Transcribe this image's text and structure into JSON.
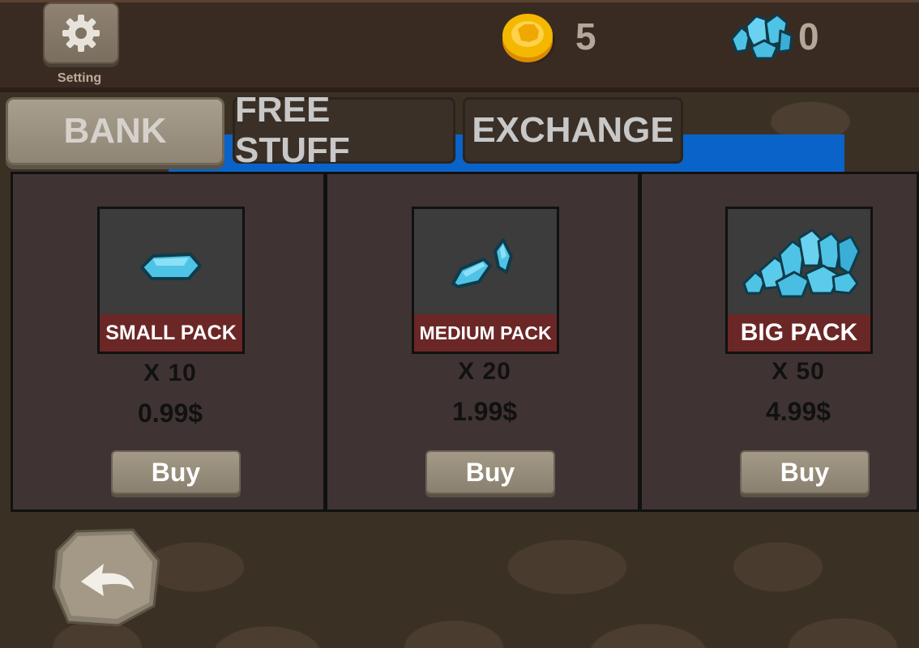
{
  "header": {
    "setting_label": "Setting",
    "coins": "5",
    "gems": "0"
  },
  "tabs": [
    {
      "label": "BANK"
    },
    {
      "label": "FREE STUFF"
    },
    {
      "label": "EXCHANGE"
    }
  ],
  "packs": [
    {
      "name": "SMALL PACK",
      "quantity": "X 10",
      "price": "0.99$",
      "buy_label": "Buy"
    },
    {
      "name": "MEDIUM PACK",
      "quantity": "X 20",
      "price": "1.99$",
      "buy_label": "Buy"
    },
    {
      "name": "BIG PACK",
      "quantity": "X 50",
      "price": "4.99$",
      "buy_label": "Buy"
    }
  ],
  "icons": {
    "setting": "gear-icon",
    "coin": "coin-icon",
    "gem": "gem-icon",
    "back": "back-arrow-icon"
  },
  "colors": {
    "pack_label_bg": "#6b2626",
    "gem": "#4fc3e6",
    "coin": "#f4b800",
    "active_tab_strip": "#0a63c9"
  }
}
